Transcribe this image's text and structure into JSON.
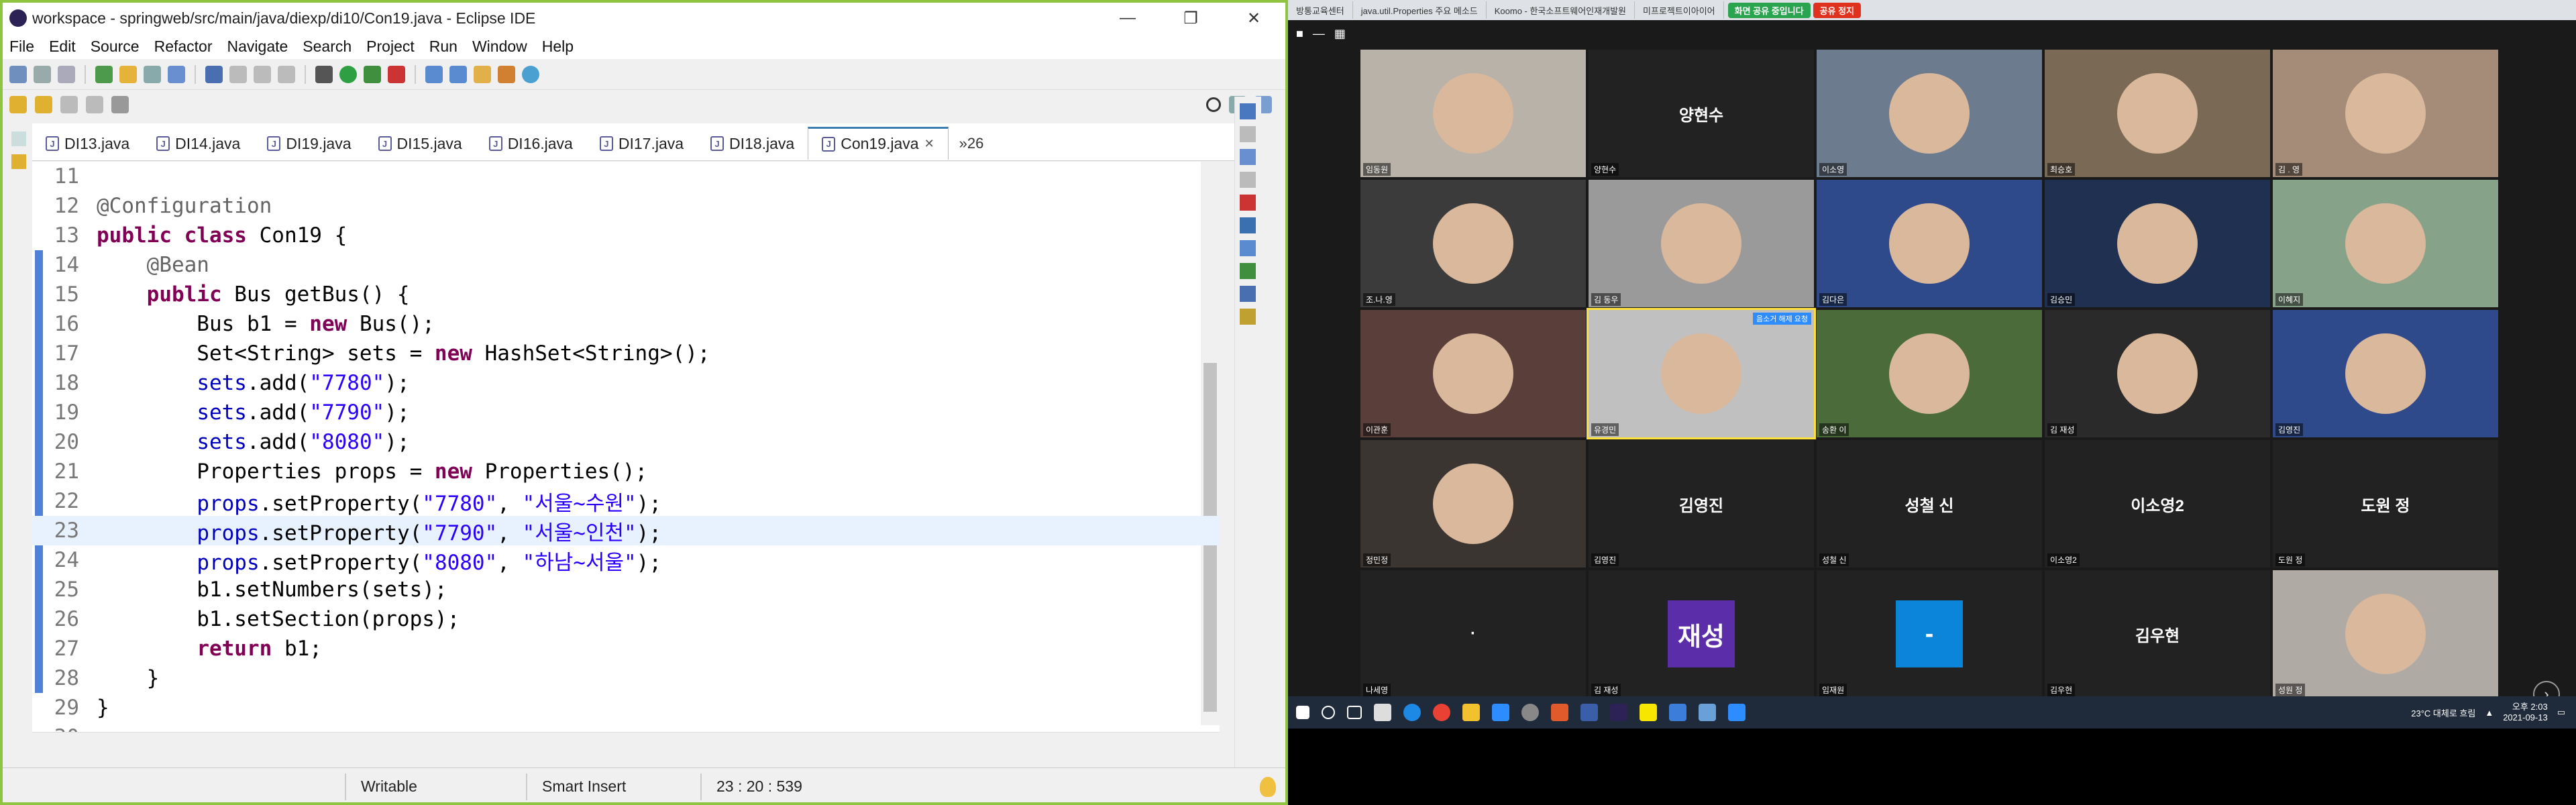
{
  "eclipse": {
    "title": "workspace - springweb/src/main/java/diexp/di10/Con19.java - Eclipse IDE",
    "menu": [
      "File",
      "Edit",
      "Source",
      "Refactor",
      "Navigate",
      "Search",
      "Project",
      "Run",
      "Window",
      "Help"
    ],
    "tabs": [
      "DI13.java",
      "DI14.java",
      "DI19.java",
      "DI15.java",
      "DI16.java",
      "DI17.java",
      "DI18.java",
      "Con19.java"
    ],
    "active_tab": "Con19.java",
    "tab_overflow": "»26",
    "code_lines": [
      {
        "n": "11",
        "text": ""
      },
      {
        "n": "12",
        "text": "@Configuration"
      },
      {
        "n": "13",
        "text": "public class Con19 {"
      },
      {
        "n": "14",
        "text": "    @Bean"
      },
      {
        "n": "15",
        "text": "    public Bus getBus() {"
      },
      {
        "n": "16",
        "text": "        Bus b1 = new Bus();"
      },
      {
        "n": "17",
        "text": "        Set<String> sets = new HashSet<String>();"
      },
      {
        "n": "18",
        "text": "        sets.add(\"7780\");"
      },
      {
        "n": "19",
        "text": "        sets.add(\"7790\");"
      },
      {
        "n": "20",
        "text": "        sets.add(\"8080\");"
      },
      {
        "n": "21",
        "text": "        Properties props = new Properties();"
      },
      {
        "n": "22",
        "text": "        props.setProperty(\"7780\", \"서울~수원\");"
      },
      {
        "n": "23",
        "text": "        props.setProperty(\"7790\", \"서울~인천\");"
      },
      {
        "n": "24",
        "text": "        props.setProperty(\"8080\", \"하남~서울\");"
      },
      {
        "n": "25",
        "text": "        b1.setNumbers(sets);"
      },
      {
        "n": "26",
        "text": "        b1.setSection(props);"
      },
      {
        "n": "27",
        "text": "        return b1;"
      },
      {
        "n": "28",
        "text": "    }"
      },
      {
        "n": "29",
        "text": "}"
      },
      {
        "n": "30",
        "text": ""
      }
    ],
    "status": {
      "mode": "Writable",
      "insert": "Smart Insert",
      "position": "23 : 20 : 539"
    }
  },
  "browser": {
    "tabs": [
      "방통교육센터",
      "java.util.Properties 주요 메소드",
      "Koomo - 한국소프트웨어인재개발원",
      "미프로젝트이아이어"
    ],
    "share_label": "화면 공유 중입니다",
    "stop_label": "공유 정지"
  },
  "zoom": {
    "tiles": [
      {
        "caption": "임동원",
        "type": "video",
        "big": ""
      },
      {
        "caption": "양현수",
        "type": "name",
        "big": "양현수"
      },
      {
        "caption": "이소영",
        "type": "video",
        "big": ""
      },
      {
        "caption": "최승호",
        "type": "video",
        "big": ""
      },
      {
        "caption": "김 . 영",
        "type": "video",
        "big": ""
      },
      {
        "caption": "조.나.영",
        "type": "video",
        "big": ""
      },
      {
        "caption": "김 동우",
        "type": "video",
        "big": ""
      },
      {
        "caption": "김다은",
        "type": "video",
        "big": ""
      },
      {
        "caption": "김승민",
        "type": "video",
        "big": ""
      },
      {
        "caption": "이혜지",
        "type": "video",
        "big": ""
      },
      {
        "caption": "이관훈",
        "type": "video",
        "big": ""
      },
      {
        "caption": "유경민",
        "type": "video",
        "big": "",
        "speaker": true,
        "badge": "음소거 해제 요청"
      },
      {
        "caption": "송환 이",
        "type": "video",
        "big": ""
      },
      {
        "caption": "김 재성",
        "type": "video",
        "big": ""
      },
      {
        "caption": "김영진",
        "type": "video",
        "big": ""
      },
      {
        "caption": "정민정",
        "type": "video",
        "big": ""
      },
      {
        "caption": "김영진",
        "type": "name",
        "big": "김영진"
      },
      {
        "caption": "성철 신",
        "type": "name",
        "big": "성철 신"
      },
      {
        "caption": "이소영2",
        "type": "name",
        "big": "이소영2"
      },
      {
        "caption": "도원 정",
        "type": "name",
        "big": "도원 정"
      },
      {
        "caption": "나세영",
        "type": "name",
        "big": "·"
      },
      {
        "caption": "김 재성",
        "type": "avatar",
        "big": "재성",
        "color": "#5b2da8"
      },
      {
        "caption": "임재원",
        "type": "avatar",
        "big": "-",
        "color": "#0a85d9"
      },
      {
        "caption": "김우현",
        "type": "name",
        "big": "김우현"
      },
      {
        "caption": "성원 정",
        "type": "video",
        "big": ""
      }
    ]
  },
  "taskbar": {
    "weather": "23°C 대체로 흐림",
    "time": "오후 2:03",
    "date": "2021-09-13"
  }
}
